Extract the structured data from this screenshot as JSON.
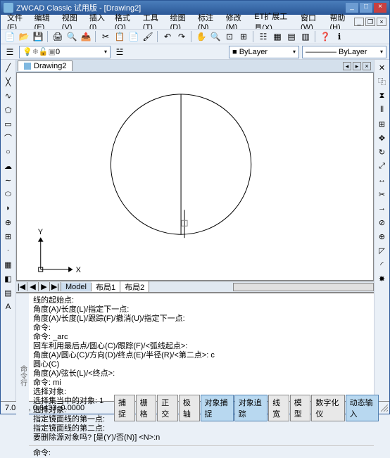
{
  "title": "ZWCAD Classic 试用版 - [Drawing2]",
  "menus": [
    "文件(F)",
    "编辑(E)",
    "视图(V)",
    "插入(I)",
    "格式(O)",
    "工具(T)",
    "绘图(D)",
    "标注(N)",
    "修改(M)",
    "ET扩展工具(X)",
    "窗口(W)",
    "帮助(H)"
  ],
  "doc_tab": "Drawing2",
  "layer_combo": "0",
  "color_combo": "■ ByLayer",
  "ltype_combo": "———— ByLayer",
  "sheet_tabs": {
    "nav": [
      "|◀",
      "◀",
      "▶",
      "▶|"
    ],
    "tabs": [
      "Model",
      "布局1",
      "布局2"
    ]
  },
  "cmd_history": "线的起始点:\n角度(A)/长度(L)/指定下一点:\n角度(A)/长度(L)/跟踪(F)/撤消(U)/指定下一点:\n命令:\n命令: _arc\n回车利用最后点/圆心(C)/跟踪(F)/<弧线起点>:\n角度(A)/圆心(C)/方向(D)/终点(E)/半径(R)/<第二点>: c\n圆心(C)\n角度(A)/弦长(L)/<终点>:\n命令: mi\n选择对象:\n选择集当中的对象: 1\n选择对象:\n指定镜面线的第一点:\n指定镜面线的第二点:\n要删除源对象吗? [是(Y)/否(N)] <N>:n",
  "cmd_prompt": "命令:",
  "cmd_side": "命令行",
  "coords": "7.0343, 0.6433, 0.0000",
  "status_buttons": [
    {
      "l": "捕捉",
      "on": false
    },
    {
      "l": "栅格",
      "on": false
    },
    {
      "l": "正交",
      "on": false
    },
    {
      "l": "极轴",
      "on": false
    },
    {
      "l": "对象捕捉",
      "on": true
    },
    {
      "l": "对象追踪",
      "on": true
    },
    {
      "l": "线宽",
      "on": false
    },
    {
      "l": "模型",
      "on": false
    },
    {
      "l": "数字化仪",
      "on": false
    },
    {
      "l": "动态输入",
      "on": true
    }
  ],
  "axis": {
    "x": "X",
    "y": "Y"
  }
}
